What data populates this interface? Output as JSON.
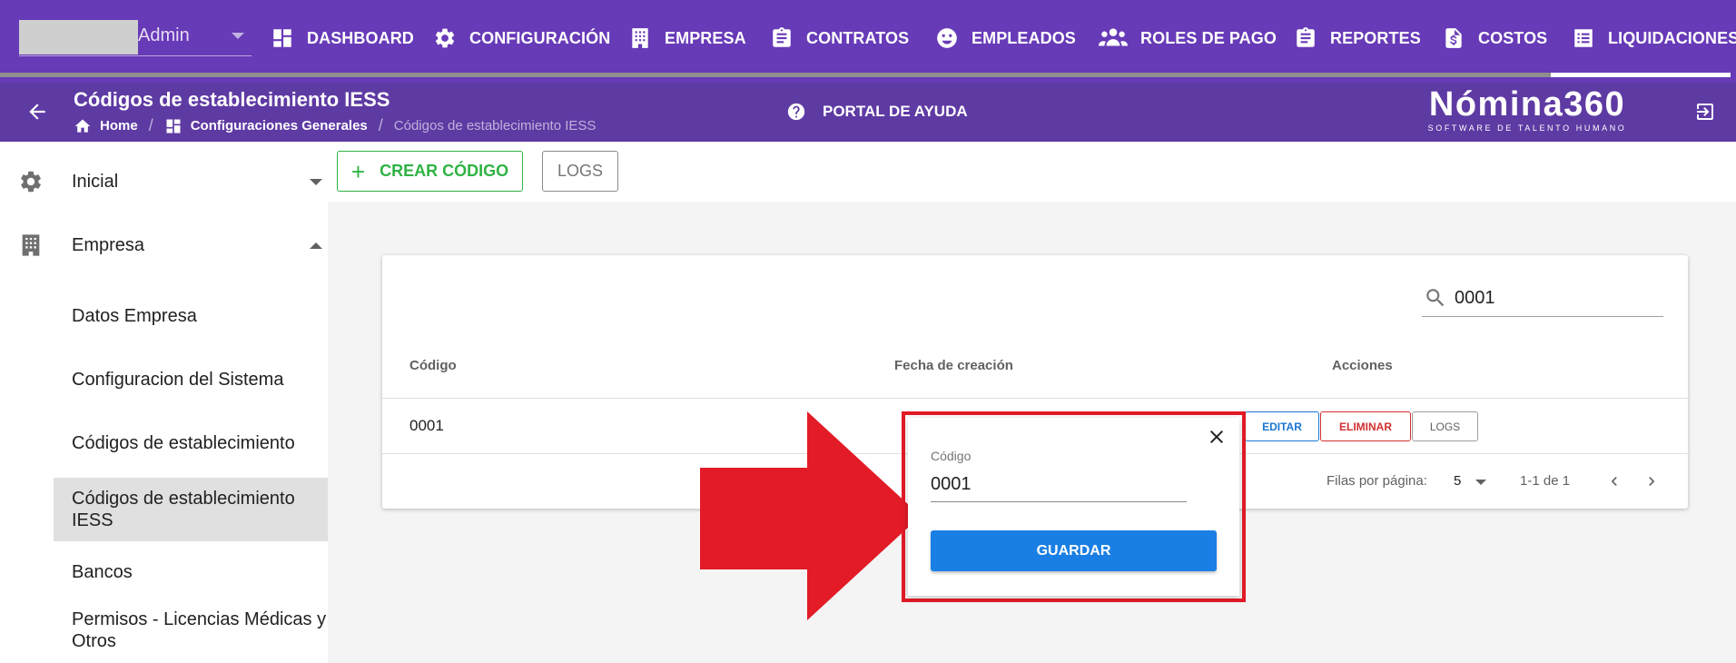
{
  "colors": {
    "nav_bg": "#673ab7",
    "subheader_bg": "#5e3aa3",
    "create_green": "#2fb344",
    "edit_blue": "#1976d2",
    "delete_red": "#d32f2f",
    "save_blue": "#1a7fe4",
    "annotation_red": "#e21b27"
  },
  "topnav": {
    "company": "Admin",
    "items": [
      {
        "label": "DASHBOARD",
        "icon": "dashboard-icon"
      },
      {
        "label": "CONFIGURACIÓN",
        "icon": "gear-icon"
      },
      {
        "label": "EMPRESA",
        "icon": "building-icon"
      },
      {
        "label": "CONTRATOS",
        "icon": "clipboard-icon"
      },
      {
        "label": "EMPLEADOS",
        "icon": "face-icon"
      },
      {
        "label": "ROLES DE PAGO",
        "icon": "group-icon"
      },
      {
        "label": "REPORTES",
        "icon": "clipboard-icon"
      },
      {
        "label": "COSTOS",
        "icon": "dollar-document-icon"
      },
      {
        "label": "LIQUIDACIONES",
        "icon": "list-icon"
      }
    ]
  },
  "subheader": {
    "title": "Códigos de establecimiento IESS",
    "breadcrumb": {
      "home": "Home",
      "section": "Configuraciones Generales",
      "current": "Códigos de establecimiento IESS"
    },
    "help": "PORTAL DE AYUDA",
    "logo": {
      "main": "Nómina360",
      "sub": "SOFTWARE DE TALENTO HUMANO"
    }
  },
  "sidebar": {
    "sections": [
      {
        "label": "Inicial",
        "icon": "gear-icon",
        "expanded": false
      },
      {
        "label": "Empresa",
        "icon": "building-icon",
        "expanded": true
      }
    ],
    "items": [
      {
        "label": "Datos Empresa",
        "active": false
      },
      {
        "label": "Configuracion del Sistema",
        "active": false
      },
      {
        "label": "Códigos de establecimiento",
        "active": false
      },
      {
        "label": "Códigos de establecimiento IESS",
        "active": true
      },
      {
        "label": "Bancos",
        "active": false
      },
      {
        "label": "Permisos - Licencias Médicas y Otros",
        "active": false
      }
    ]
  },
  "toolbar": {
    "create_label": "CREAR CÓDIGO",
    "create_plus": "+",
    "logs_label": "LOGS"
  },
  "table": {
    "search_value": "0001",
    "columns": [
      "Código",
      "Fecha de creación",
      "Acciones"
    ],
    "rows": [
      {
        "codigo": "0001",
        "fecha": ""
      }
    ],
    "actions": {
      "edit": "EDITAR",
      "delete": "ELIMINAR",
      "logs": "LOGS"
    },
    "pagination": {
      "rows_per_page_label": "Filas por página:",
      "rows_per_page": "5",
      "range": "1-1 de 1"
    }
  },
  "popup": {
    "field_label": "Código",
    "field_value": "0001",
    "save_label": "GUARDAR"
  }
}
